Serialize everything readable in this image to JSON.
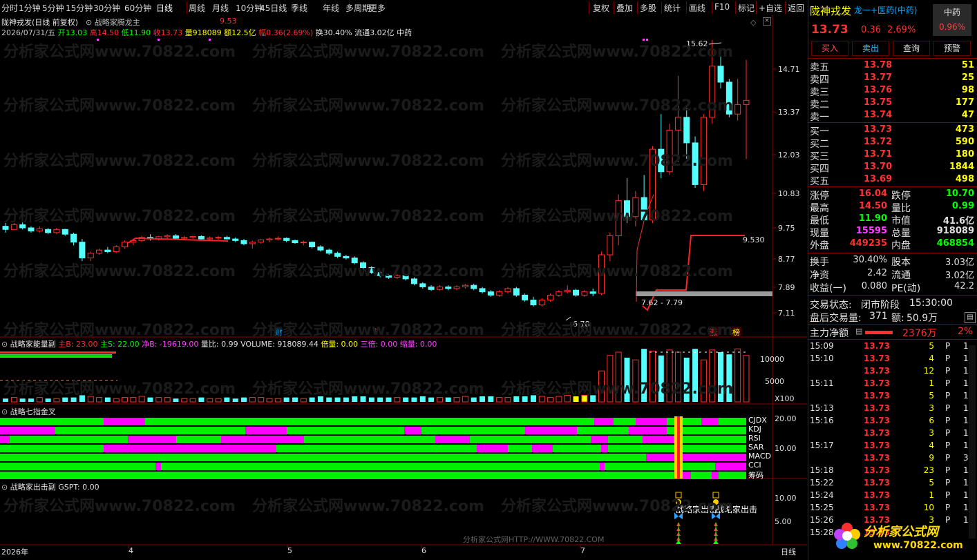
{
  "toolbar": {
    "periods": [
      "分时",
      "1分钟",
      "5分钟",
      "15分钟",
      "30分钟",
      "60分钟",
      "日线",
      "周线",
      "月线",
      "10分钟",
      "45日线",
      "季线",
      "年线",
      "多周期",
      "更多"
    ],
    "tools": [
      "复权",
      "叠加",
      "多股",
      "统计",
      "画线",
      "F10",
      "标记",
      "+自选",
      "返回"
    ]
  },
  "chart_header": {
    "title": "陇神戎发(日线 前复权)",
    "indicator": "战略家腾龙主",
    "indicator_value": "9.53",
    "date": "2026/07/31/五",
    "open_label": "开",
    "open": "13.03",
    "high_label": "高",
    "high": "14.50",
    "low_label": "低",
    "low": "11.90",
    "close_label": "收",
    "close": "13.73",
    "vol_label": "量",
    "vol": "918089",
    "amount_label": "额",
    "amount": "12.5亿",
    "change_label": "幅",
    "change": "0.36(2.69%)",
    "turnover": "换30.40%",
    "float_label": "流通",
    "float": "3.02亿",
    "sector": "中药"
  },
  "price_axis": [
    "14.71",
    "13.37",
    "12.03",
    "10.83",
    "9.75",
    "8.77",
    "7.89",
    "7.11"
  ],
  "annotations": {
    "high_mark": "15.62",
    "low_mark": "6.78",
    "range_mark": "7.62 - 7.79",
    "line_value": "9.530",
    "fin_mark": "财",
    "dollar_mark": "$",
    "zhang": "涨",
    "bang": "榜"
  },
  "volume_panel": {
    "title": "战略家能量副",
    "main_b": "主B: 23.00",
    "main_s": "主S: 22.00",
    "net_b": "净B: -19619.00",
    "ratio": "量比: 0.99",
    "volume": "VOLUME: 918089.44",
    "double": "倍量: 0.00",
    "triple": "三倍: 0.00",
    "shrink": "缩量: 0.00",
    "axis": [
      "10000",
      "5000"
    ],
    "unit": "X100"
  },
  "seven_panel": {
    "title": "战略七指金叉",
    "labels": [
      "CJDX",
      "KDJ",
      "RSI",
      "SAR",
      "MACD",
      "CCI",
      "筹码"
    ],
    "axis": [
      "20.00",
      "10.00"
    ]
  },
  "attack_panel": {
    "title": "战略家出击副",
    "value": "GSPT: 0.00",
    "axis": [
      "10.00",
      "5.00"
    ],
    "signal": "战略家出击",
    "footer": "分析家公式网HTTP://WWW.70822.COM"
  },
  "time_axis": [
    "2026年",
    "4",
    "5",
    "6",
    "7"
  ],
  "period_label": "日线",
  "watermark": "分析家公式网www.70822.com",
  "quote": {
    "name": "陇神戎发",
    "sector_tag": "龙一+医药(中药)",
    "sector_box": "中药",
    "sector_pct": "0.96%",
    "price": "13.73",
    "change": "0.36",
    "pct": "2.69%",
    "buttons": [
      "买入",
      "卖出",
      "查询",
      "预警"
    ],
    "asks": [
      {
        "label": "卖五",
        "price": "13.78",
        "vol": "51"
      },
      {
        "label": "卖四",
        "price": "13.77",
        "vol": "25"
      },
      {
        "label": "卖三",
        "price": "13.76",
        "vol": "98"
      },
      {
        "label": "卖二",
        "price": "13.75",
        "vol": "177"
      },
      {
        "label": "卖一",
        "price": "13.74",
        "vol": "47"
      }
    ],
    "bids": [
      {
        "label": "买一",
        "price": "13.73",
        "vol": "473"
      },
      {
        "label": "买二",
        "price": "13.72",
        "vol": "590"
      },
      {
        "label": "买三",
        "price": "13.71",
        "vol": "180"
      },
      {
        "label": "买四",
        "price": "13.70",
        "vol": "1844"
      },
      {
        "label": "买五",
        "price": "13.69",
        "vol": "498"
      }
    ],
    "stats": [
      {
        "l1": "涨停",
        "v1": "16.04",
        "l2": "跌停",
        "v2": "10.70"
      },
      {
        "l1": "最高",
        "v1": "14.50",
        "l2": "量比",
        "v2": "0.99"
      },
      {
        "l1": "最低",
        "v1": "11.90",
        "l2": "市值",
        "v2": "41.6亿"
      },
      {
        "l1": "现量",
        "v1": "15595",
        "l2": "总量",
        "v2": "918089"
      },
      {
        "l1": "外盘",
        "v1": "449235",
        "l2": "内盘",
        "v2": "468854"
      }
    ],
    "stats2": [
      {
        "l1": "换手",
        "v1": "30.40%",
        "l2": "股本",
        "v2": "3.03亿"
      },
      {
        "l1": "净资",
        "v1": "2.42",
        "l2": "流通",
        "v2": "3.02亿"
      },
      {
        "l1": "收益(一)",
        "v1": "0.080",
        "l2": "PE(动)",
        "v2": "42.2"
      }
    ],
    "status_label": "交易状态:",
    "status": "闭市阶段",
    "status_time": "15:30:00",
    "after_label": "盘后交易量:",
    "after_vol": "371",
    "after_amt_label": "额:",
    "after_amt": "50.9万",
    "main_net_label": "主力净额",
    "main_net": "2376万",
    "main_net_pct": "2%",
    "ticks": [
      {
        "t": "15:09",
        "p": "13.73",
        "v": "5",
        "d": "P",
        "n": "1"
      },
      {
        "t": "15:10",
        "p": "13.73",
        "v": "4",
        "d": "P",
        "n": "1"
      },
      {
        "t": "",
        "p": "13.73",
        "v": "12",
        "d": "P",
        "n": "1"
      },
      {
        "t": "15:11",
        "p": "13.73",
        "v": "1",
        "d": "P",
        "n": "1"
      },
      {
        "t": "",
        "p": "13.73",
        "v": "5",
        "d": "P",
        "n": "1"
      },
      {
        "t": "15:13",
        "p": "13.73",
        "v": "3",
        "d": "P",
        "n": "1"
      },
      {
        "t": "15:16",
        "p": "13.73",
        "v": "6",
        "d": "P",
        "n": "1"
      },
      {
        "t": "",
        "p": "13.73",
        "v": "3",
        "d": "P",
        "n": "1"
      },
      {
        "t": "15:17",
        "p": "13.73",
        "v": "4",
        "d": "P",
        "n": "1"
      },
      {
        "t": "",
        "p": "13.73",
        "v": "9",
        "d": "P",
        "n": "3"
      },
      {
        "t": "15:18",
        "p": "13.73",
        "v": "23",
        "d": "P",
        "n": "1"
      },
      {
        "t": "15:22",
        "p": "13.73",
        "v": "5",
        "d": "P",
        "n": "1"
      },
      {
        "t": "15:24",
        "p": "13.73",
        "v": "1",
        "d": "P",
        "n": "1"
      },
      {
        "t": "15:25",
        "p": "13.73",
        "v": "10",
        "d": "P",
        "n": "1"
      },
      {
        "t": "15:26",
        "p": "13.73",
        "v": "3",
        "d": "P",
        "n": "1"
      },
      {
        "t": "15:28",
        "p": "13.73",
        "v": "",
        "d": "",
        "n": ""
      }
    ],
    "logo": "分析家公式网",
    "logo_url": "www.70822.com"
  },
  "candles": [
    [
      9.8,
      9.9,
      9.6,
      9.7
    ],
    [
      9.7,
      9.9,
      9.7,
      9.85
    ],
    [
      9.85,
      9.95,
      9.7,
      9.75
    ],
    [
      9.75,
      9.8,
      9.6,
      9.65
    ],
    [
      9.65,
      9.8,
      9.6,
      9.72
    ],
    [
      9.7,
      9.75,
      9.55,
      9.6
    ],
    [
      9.6,
      9.75,
      9.55,
      9.7
    ],
    [
      9.7,
      9.72,
      9.5,
      9.55
    ],
    [
      9.55,
      9.6,
      9.2,
      9.3
    ],
    [
      9.3,
      9.4,
      8.7,
      8.8
    ],
    [
      8.8,
      9.0,
      8.7,
      8.95
    ],
    [
      8.95,
      9.1,
      8.9,
      9.05
    ],
    [
      9.05,
      9.15,
      8.95,
      9.0
    ],
    [
      9.0,
      9.2,
      8.95,
      9.15
    ],
    [
      9.15,
      9.35,
      9.1,
      9.3
    ],
    [
      9.3,
      9.4,
      9.2,
      9.35
    ],
    [
      9.35,
      9.5,
      9.3,
      9.45
    ],
    [
      9.45,
      9.55,
      9.35,
      9.4
    ],
    [
      9.4,
      9.5,
      9.35,
      9.47
    ],
    [
      9.47,
      9.55,
      9.4,
      9.5
    ],
    [
      9.5,
      9.55,
      9.4,
      9.42
    ],
    [
      9.42,
      9.5,
      9.38,
      9.45
    ],
    [
      9.45,
      9.5,
      9.4,
      9.48
    ],
    [
      9.48,
      9.52,
      9.35,
      9.4
    ],
    [
      9.4,
      9.48,
      9.35,
      9.43
    ],
    [
      9.43,
      9.5,
      9.38,
      9.45
    ],
    [
      9.45,
      9.5,
      9.38,
      9.4
    ],
    [
      9.4,
      9.45,
      9.3,
      9.35
    ],
    [
      9.35,
      9.4,
      9.2,
      9.25
    ],
    [
      9.25,
      9.35,
      9.1,
      9.3
    ],
    [
      9.3,
      9.4,
      9.25,
      9.37
    ],
    [
      9.37,
      9.45,
      9.3,
      9.4
    ],
    [
      9.4,
      9.48,
      9.35,
      9.42
    ],
    [
      9.42,
      9.45,
      9.3,
      9.35
    ],
    [
      9.35,
      9.38,
      9.25,
      9.28
    ],
    [
      9.28,
      9.35,
      9.2,
      9.3
    ],
    [
      9.3,
      9.32,
      9.1,
      9.15
    ],
    [
      9.15,
      9.2,
      9.0,
      9.05
    ],
    [
      9.05,
      9.1,
      8.9,
      8.95
    ],
    [
      8.95,
      9.0,
      8.8,
      8.85
    ],
    [
      8.85,
      8.9,
      8.75,
      8.8
    ],
    [
      8.8,
      8.85,
      8.6,
      8.65
    ],
    [
      8.65,
      8.7,
      8.45,
      8.5
    ],
    [
      8.5,
      8.55,
      8.3,
      8.35
    ],
    [
      8.35,
      8.4,
      8.2,
      8.25
    ],
    [
      8.25,
      8.3,
      8.15,
      8.2
    ],
    [
      8.2,
      8.3,
      8.15,
      8.25
    ],
    [
      8.25,
      8.3,
      8.1,
      8.15
    ],
    [
      8.15,
      8.2,
      7.95,
      8.0
    ],
    [
      8.0,
      8.05,
      7.85,
      7.9
    ],
    [
      7.9,
      7.95,
      7.78,
      7.82
    ],
    [
      7.82,
      7.95,
      7.78,
      7.9
    ],
    [
      7.9,
      7.95,
      7.8,
      7.85
    ],
    [
      7.85,
      7.95,
      7.8,
      7.9
    ],
    [
      7.9,
      8.0,
      7.85,
      7.95
    ],
    [
      7.95,
      8.0,
      7.8,
      7.85
    ],
    [
      7.85,
      7.9,
      7.7,
      7.75
    ],
    [
      7.75,
      7.8,
      7.6,
      7.65
    ],
    [
      7.65,
      7.8,
      7.6,
      7.75
    ],
    [
      7.75,
      7.9,
      7.7,
      7.85
    ],
    [
      7.85,
      7.9,
      7.6,
      7.65
    ],
    [
      7.65,
      7.7,
      7.45,
      7.5
    ],
    [
      7.5,
      7.6,
      7.3,
      7.35
    ],
    [
      7.35,
      7.55,
      7.3,
      7.5
    ],
    [
      7.5,
      7.7,
      7.45,
      7.65
    ],
    [
      7.65,
      7.8,
      7.6,
      7.75
    ],
    [
      7.75,
      7.95,
      7.7,
      7.8
    ],
    [
      7.8,
      7.85,
      7.6,
      7.65
    ],
    [
      7.65,
      7.8,
      7.6,
      7.75
    ],
    [
      7.75,
      7.85,
      7.62,
      7.7
    ],
    [
      7.7,
      9.0,
      7.65,
      8.9
    ],
    [
      8.9,
      9.6,
      8.7,
      9.5
    ],
    [
      9.5,
      10.8,
      9.2,
      10.6
    ],
    [
      10.6,
      11.3,
      9.9,
      10.1
    ],
    [
      10.1,
      10.9,
      9.8,
      10.7
    ],
    [
      10.7,
      11.4,
      10.2,
      10.0
    ],
    [
      10.0,
      12.3,
      9.9,
      12.2
    ],
    [
      12.2,
      13.3,
      11.3,
      11.5
    ],
    [
      11.5,
      13.0,
      11.4,
      12.8
    ],
    [
      12.8,
      14.5,
      11.8,
      13.2
    ],
    [
      13.2,
      13.5,
      11.9,
      12.4
    ],
    [
      12.4,
      12.6,
      11.0,
      11.1
    ],
    [
      11.1,
      13.3,
      10.9,
      13.2
    ],
    [
      13.2,
      15.62,
      13.0,
      14.8
    ],
    [
      14.8,
      15.1,
      14.1,
      14.3
    ],
    [
      14.3,
      14.4,
      13.2,
      13.3
    ],
    [
      13.3,
      14.4,
      13.1,
      13.6
    ],
    [
      13.6,
      15.0,
      11.9,
      13.73
    ]
  ],
  "volume_bars": [
    3,
    4,
    3,
    3,
    4,
    3,
    3,
    4,
    4,
    6,
    5,
    4,
    4,
    3,
    4,
    4,
    5,
    4,
    4,
    4,
    3,
    3,
    3,
    4,
    3,
    3,
    4,
    3,
    4,
    4,
    4,
    3,
    3,
    4,
    4,
    3,
    4,
    5,
    4,
    4,
    4,
    5,
    5,
    4,
    4,
    4,
    4,
    4,
    4,
    5,
    4,
    4,
    4,
    4,
    5,
    4,
    5,
    5,
    4,
    4,
    5,
    5,
    6,
    5,
    4,
    5,
    6,
    5,
    6,
    6,
    28,
    42,
    45,
    40,
    38,
    48,
    46,
    42,
    47,
    45,
    40,
    48,
    38,
    47,
    45,
    43,
    48,
    42
  ]
}
